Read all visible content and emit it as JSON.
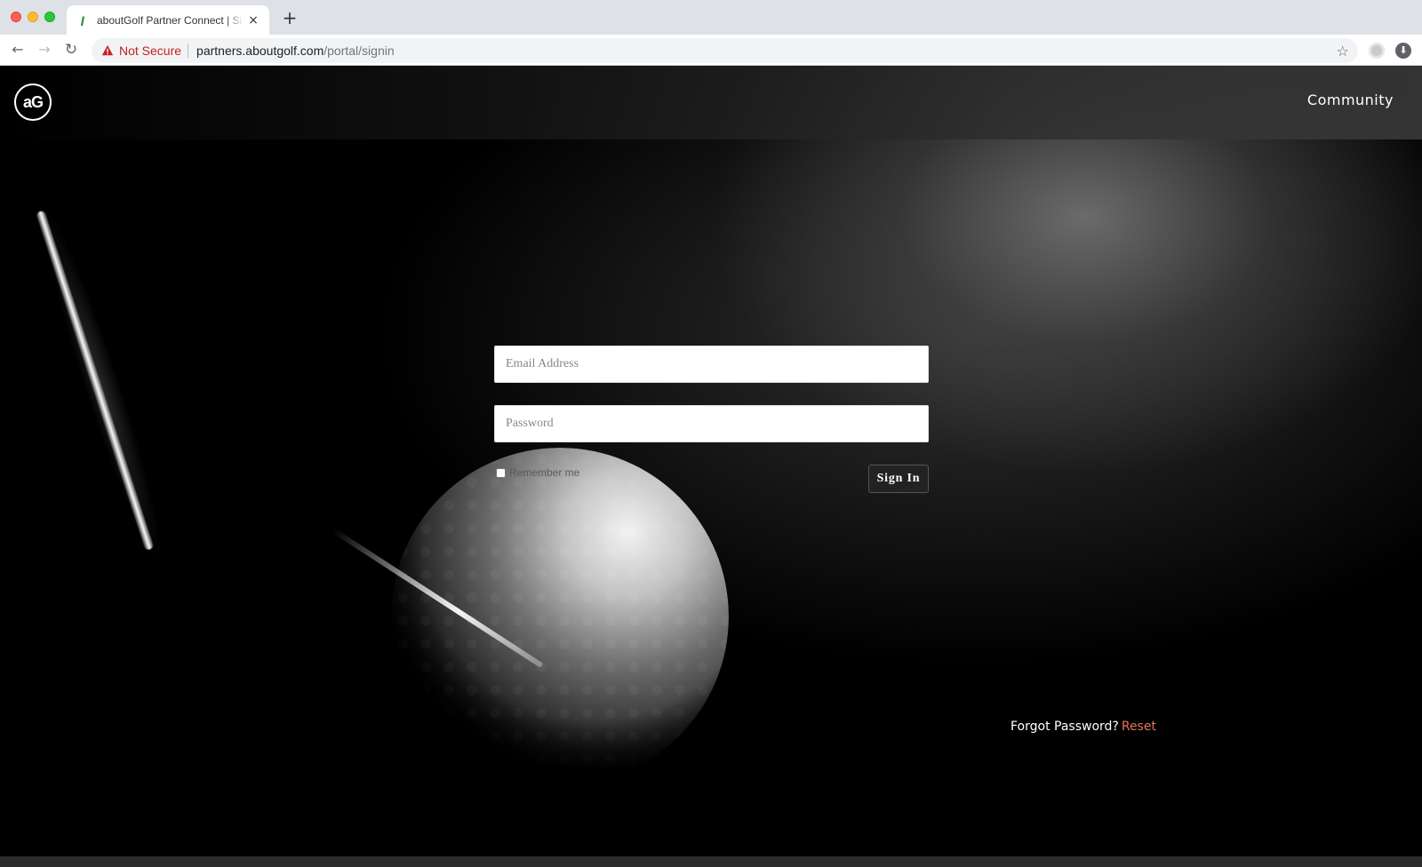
{
  "browser": {
    "tab": {
      "title": "aboutGolf Partner Connect | Si",
      "close_glyph": "×",
      "favicon": "ꞁ"
    },
    "new_tab_glyph": "+",
    "nav": {
      "back": "←",
      "forward": "→",
      "reload": "↻"
    },
    "omnibox": {
      "security_text": "Not Secure",
      "url_host": "partners.aboutgolf.com",
      "url_path": "/portal/signin"
    },
    "star_glyph": "☆",
    "download_glyph": "⬇"
  },
  "header": {
    "logo_text": "aG",
    "community_label": "Community"
  },
  "signin_form": {
    "email_placeholder": "Email Address",
    "password_placeholder": "Password",
    "remember_label": "Remember me",
    "signin_label": "Sign In"
  },
  "footer": {
    "forgot_text": "Forgot Password?",
    "reset_label": "Reset"
  },
  "colors": {
    "accent_link": "#e8745b",
    "not_secure": "#c5221f"
  }
}
